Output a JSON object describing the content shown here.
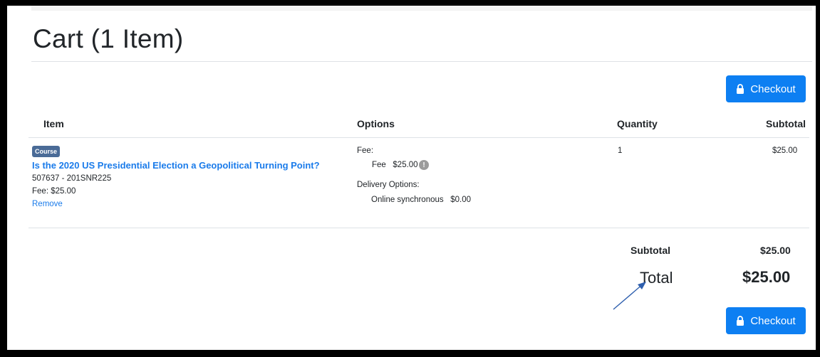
{
  "page": {
    "title": "Cart (1 Item)",
    "checkout_label": "Checkout"
  },
  "table": {
    "headers": {
      "item": "Item",
      "options": "Options",
      "quantity": "Quantity",
      "subtotal": "Subtotal"
    }
  },
  "cart_item": {
    "badge": "Course",
    "title": "Is the 2020 US Presidential Election a Geopolitical Turning Point?",
    "code": "507637 - 201SNR225",
    "fee_line": "Fee: $25.00",
    "remove_label": "Remove",
    "options": {
      "fee_heading": "Fee:",
      "fee_line": "Fee   $25.00",
      "delivery_heading": "Delivery Options:",
      "delivery_line": "Online synchronous   $0.00"
    },
    "quantity": "1",
    "subtotal": "$25.00"
  },
  "summary": {
    "subtotal_label": "Subtotal",
    "subtotal_value": "$25.00",
    "total_label": "Total",
    "total_value": "$25.00"
  },
  "icons": {
    "lock": "lock-icon",
    "info": "info-icon",
    "annotation": "arrow-annotation"
  },
  "colors": {
    "primary": "#0d7ff2",
    "link": "#1a7bea",
    "badge": "#4a6b97",
    "arrow": "#2e5fae"
  }
}
